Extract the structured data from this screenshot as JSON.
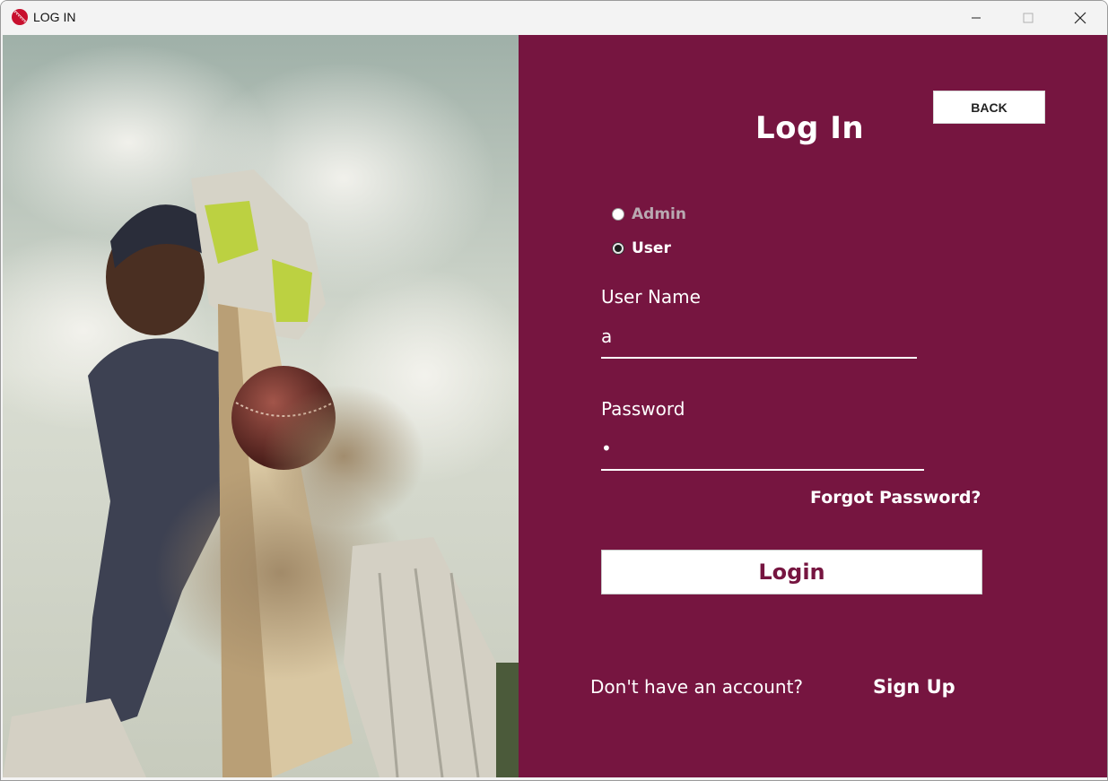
{
  "window": {
    "title": "LOG IN",
    "icon": "cricket-ball-icon",
    "controls": [
      "minimize-icon",
      "maximize-icon",
      "close-icon"
    ]
  },
  "colors": {
    "panel_background": "#761540",
    "text_primary": "#ffffff",
    "button_background": "#ffffff",
    "login_button_text": "#761540",
    "admin_label_disabled": "#b9a9b1"
  },
  "photo": {
    "subject": "cricket batsman hitting ball"
  },
  "login": {
    "back_label": "BACK",
    "title": "Log In",
    "roles": [
      {
        "label": "Admin",
        "selected": false
      },
      {
        "label": "User",
        "selected": true
      }
    ],
    "username_label": "User Name",
    "username_value": "a",
    "password_label": "Password",
    "password_value": "•",
    "forgot_label": "Forgot Password?",
    "login_label": "Login",
    "signup_prompt": "Don't have an account?",
    "signup_label": "Sign Up"
  }
}
